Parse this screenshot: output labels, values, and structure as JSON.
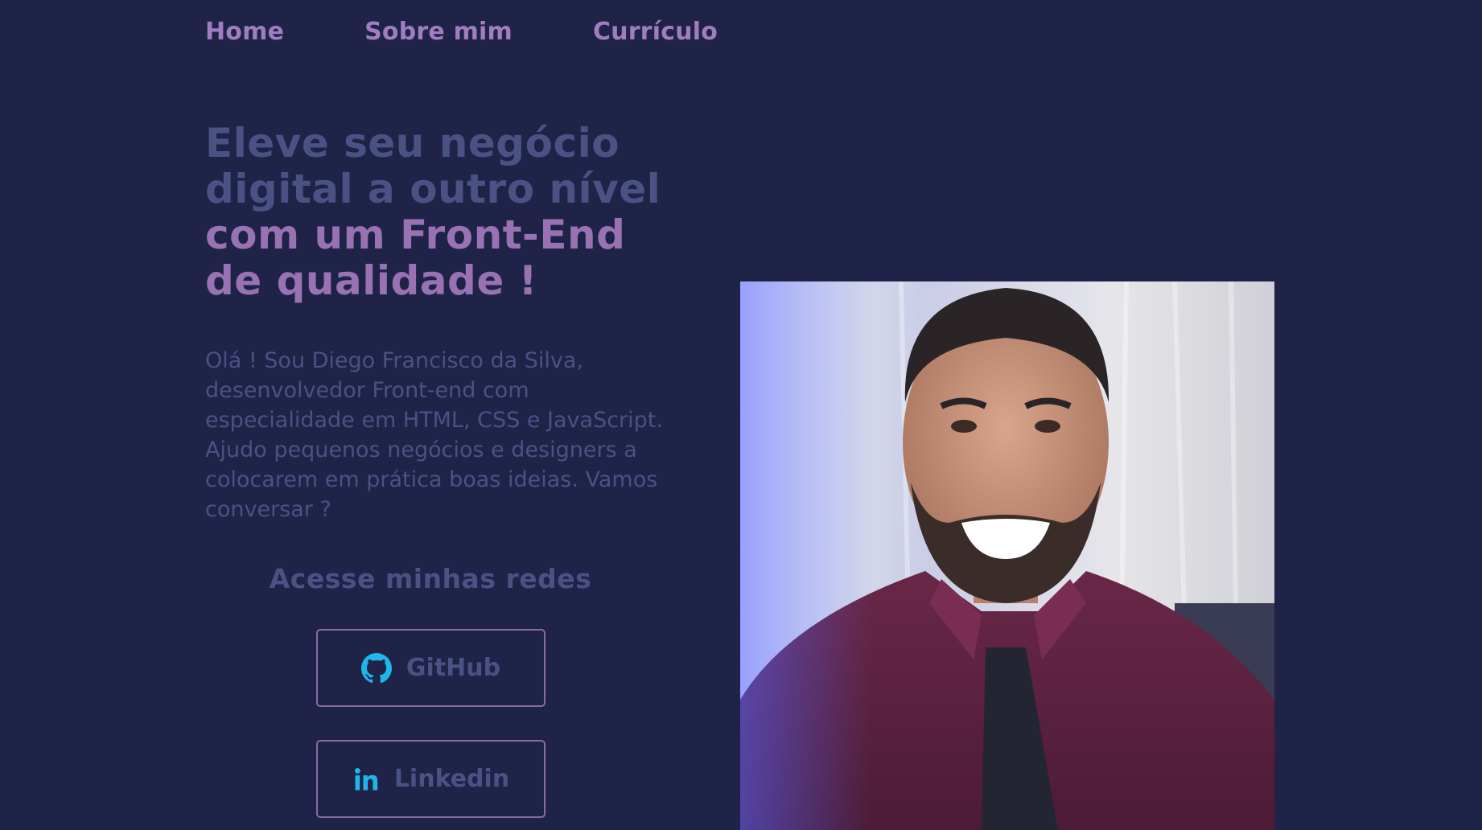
{
  "nav": {
    "items": [
      {
        "label": "Home"
      },
      {
        "label": "Sobre mim"
      },
      {
        "label": "Currículo"
      }
    ]
  },
  "hero": {
    "headline_part1": "Eleve seu negócio digital a outro nível",
    "headline_part2": "com um Front-End de qualidade !",
    "intro": "Olá ! Sou Diego Francisco da Silva, desenvolvedor Front-end com especialidade em HTML, CSS e JavaScript. Ajudo pequenos negócios e designers a colocarem em prática boas ideias. Vamos conversar ?"
  },
  "social": {
    "title": "Acesse minhas redes",
    "buttons": [
      {
        "label": "GitHub",
        "icon": "github-icon"
      },
      {
        "label": "Linkedin",
        "icon": "linkedin-icon"
      }
    ]
  },
  "colors": {
    "background": "#1f2347",
    "accent_purple": "#9872b3",
    "muted_text": "#4a5284",
    "icon_cyan": "#1fb6ea",
    "button_border": "#8b6aa8"
  }
}
